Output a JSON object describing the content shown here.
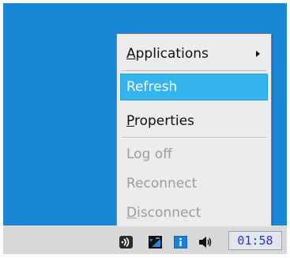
{
  "desktop": {
    "background_color": "#1a87d6"
  },
  "menu": {
    "items": [
      {
        "first": "A",
        "rest": "pplications",
        "has_submenu": true,
        "state": "normal"
      },
      {
        "first": "",
        "rest": "Refresh",
        "state": "highlighted"
      },
      {
        "first": "P",
        "rest": "roperties",
        "state": "normal"
      },
      {
        "first": "",
        "rest": "Log off",
        "state": "disabled"
      },
      {
        "first": "",
        "rest": "Reconnect",
        "state": "disabled"
      },
      {
        "first": "D",
        "rest": "isconnect",
        "state": "disabled"
      }
    ],
    "highlight_color": "#35b5ee"
  },
  "taskbar": {
    "tray_icons": [
      "network-icon",
      "display-icon",
      "info-icon",
      "speaker-icon"
    ],
    "clock": "01:58"
  }
}
